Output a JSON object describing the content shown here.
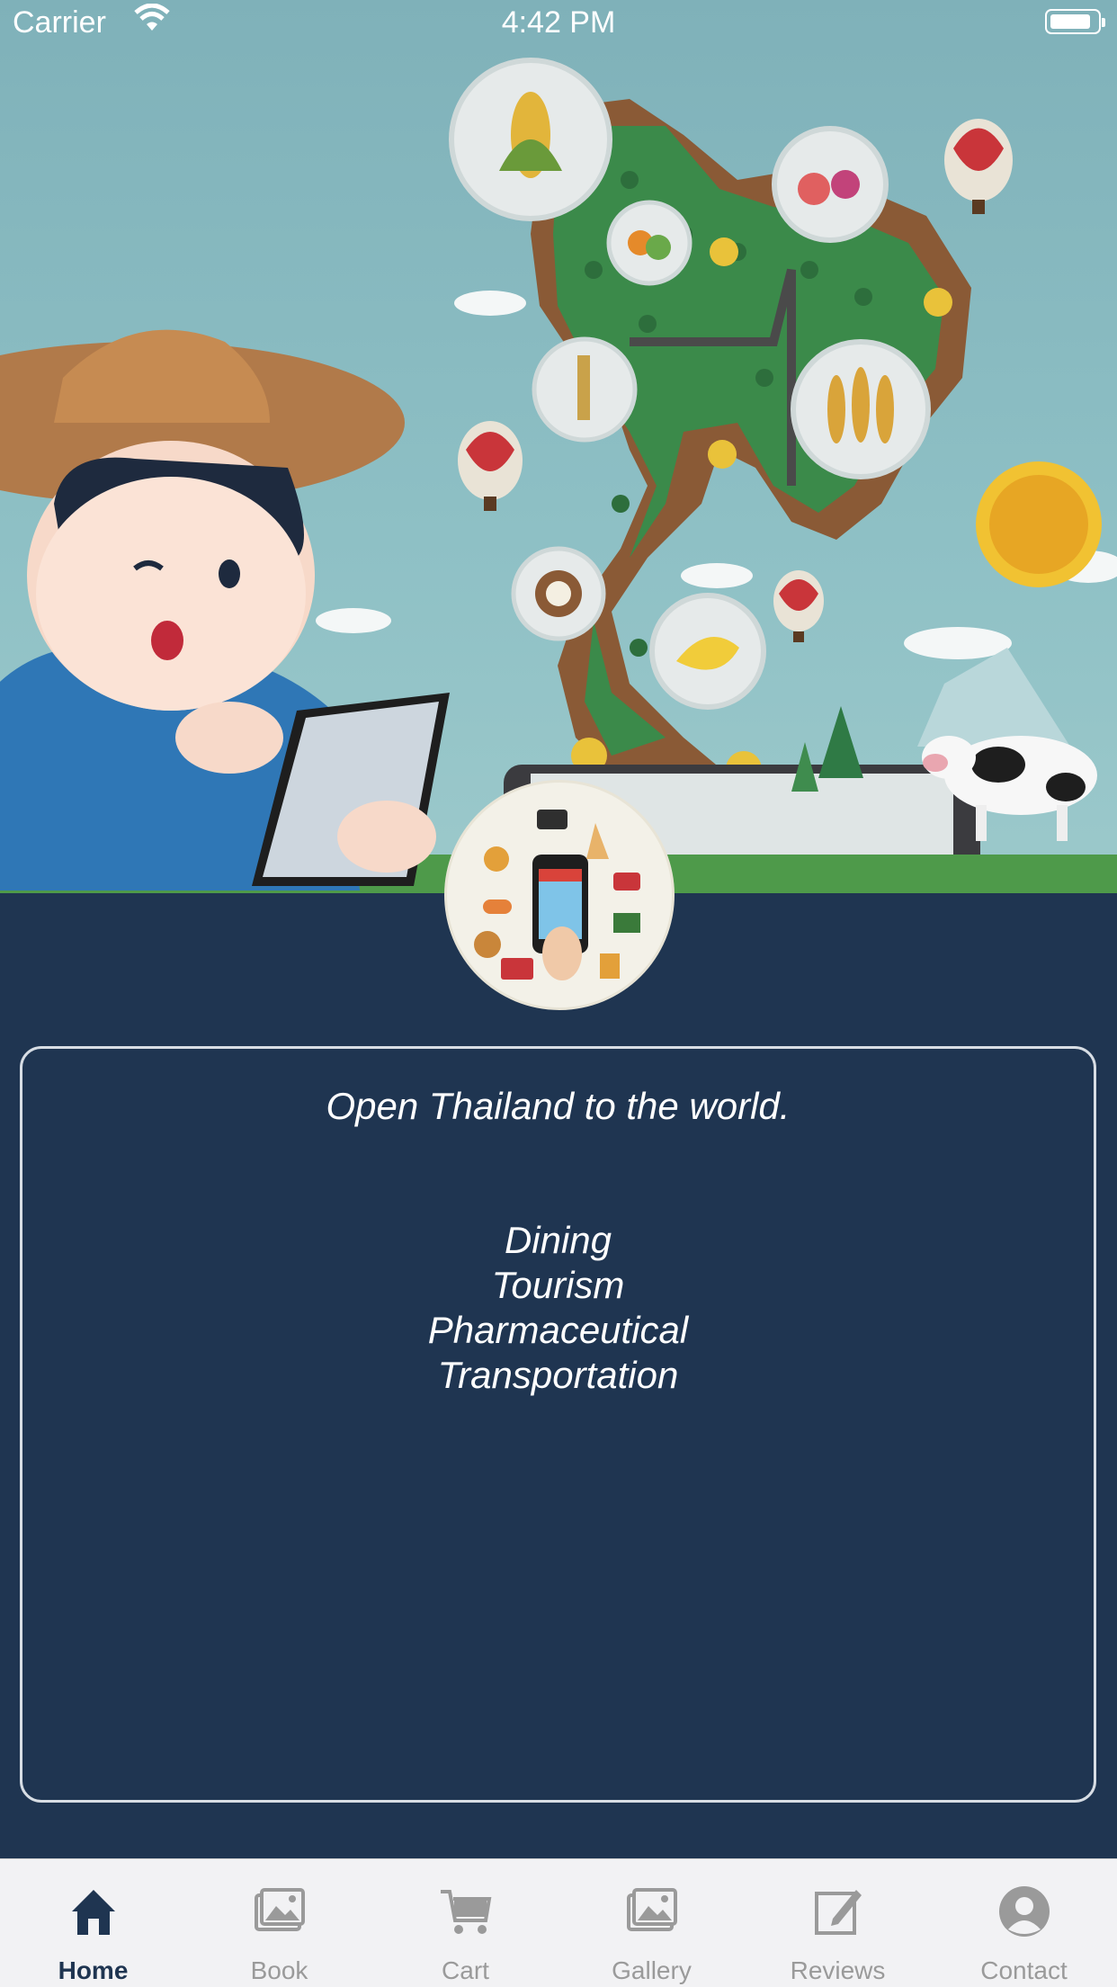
{
  "status_bar": {
    "carrier": "Carrier",
    "time": "4:42 PM"
  },
  "hero": {
    "alt_icon": "thailand-agriculture-illustration"
  },
  "info": {
    "tagline": "Open Thailand to the world.",
    "categories": [
      "Dining",
      "Tourism",
      "Pharmaceutical",
      "Transportation"
    ]
  },
  "tabs": [
    {
      "label": "Home",
      "icon": "home-icon",
      "active": true
    },
    {
      "label": "Book",
      "icon": "photo-icon",
      "active": false
    },
    {
      "label": "Cart",
      "icon": "cart-icon",
      "active": false
    },
    {
      "label": "Gallery",
      "icon": "gallery-icon",
      "active": false
    },
    {
      "label": "Reviews",
      "icon": "edit-icon",
      "active": false
    },
    {
      "label": "Contact",
      "icon": "person-icon",
      "active": false
    }
  ],
  "colors": {
    "background": "#1f3551",
    "active_tab": "#1f3551",
    "inactive_tab": "#9a9a9a"
  }
}
